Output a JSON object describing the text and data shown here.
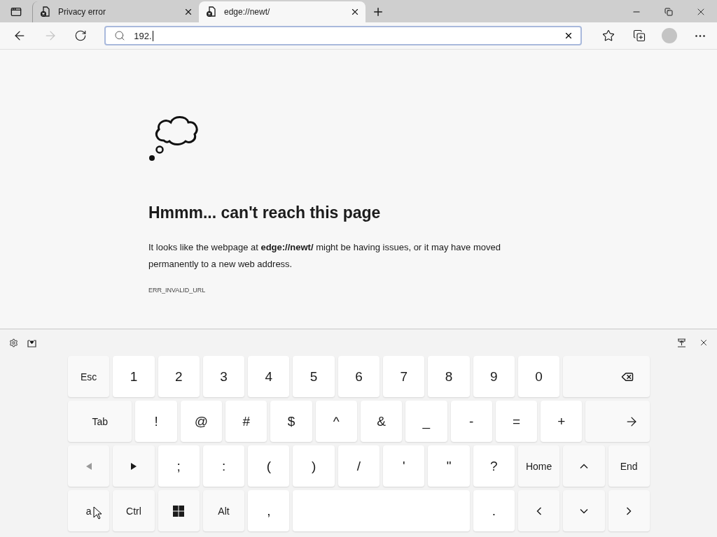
{
  "tabs": [
    {
      "title": "Privacy error",
      "selected": false
    },
    {
      "title": "edge://newt/",
      "selected": true
    }
  ],
  "address_bar": {
    "value": "192."
  },
  "error_page": {
    "heading": "Hmmm... can't reach this page",
    "message": "It looks like the webpage at **edge://newt/** might be having issues, or it may have moved permanently to a new web address.",
    "code": "ERR_INVALID_URL"
  },
  "keyboard": {
    "rows": [
      {
        "keys": [
          {
            "kind": "label",
            "label": "Esc"
          },
          {
            "kind": "char",
            "label": "1"
          },
          {
            "kind": "char",
            "label": "2"
          },
          {
            "kind": "char",
            "label": "3"
          },
          {
            "kind": "char",
            "label": "4"
          },
          {
            "kind": "char",
            "label": "5"
          },
          {
            "kind": "char",
            "label": "6"
          },
          {
            "kind": "char",
            "label": "7"
          },
          {
            "kind": "char",
            "label": "8"
          },
          {
            "kind": "char",
            "label": "9"
          },
          {
            "kind": "char",
            "label": "0"
          },
          {
            "kind": "backspace"
          }
        ]
      },
      {
        "keys": [
          {
            "kind": "tab",
            "label": "Tab"
          },
          {
            "kind": "char",
            "label": "!"
          },
          {
            "kind": "char",
            "label": "@"
          },
          {
            "kind": "char",
            "label": "#"
          },
          {
            "kind": "char",
            "label": "$"
          },
          {
            "kind": "char",
            "label": "^"
          },
          {
            "kind": "char",
            "label": "&"
          },
          {
            "kind": "char",
            "label": "_"
          },
          {
            "kind": "char",
            "label": "-"
          },
          {
            "kind": "char",
            "label": "="
          },
          {
            "kind": "char",
            "label": "+"
          },
          {
            "kind": "enter"
          }
        ]
      },
      {
        "keys": [
          {
            "kind": "prev"
          },
          {
            "kind": "next"
          },
          {
            "kind": "char",
            "label": ";"
          },
          {
            "kind": "char",
            "label": ":"
          },
          {
            "kind": "char",
            "label": "("
          },
          {
            "kind": "char",
            "label": ")"
          },
          {
            "kind": "char",
            "label": "/"
          },
          {
            "kind": "char",
            "label": "'"
          },
          {
            "kind": "char",
            "label": "\""
          },
          {
            "kind": "char",
            "label": "?"
          },
          {
            "kind": "label",
            "label": "Home"
          },
          {
            "kind": "up"
          },
          {
            "kind": "label",
            "label": "End"
          }
        ]
      },
      {
        "keys": [
          {
            "kind": "label",
            "label": "a"
          },
          {
            "kind": "label",
            "label": "Ctrl"
          },
          {
            "kind": "windows"
          },
          {
            "kind": "label",
            "label": "Alt"
          },
          {
            "kind": "char",
            "label": ","
          },
          {
            "kind": "space"
          },
          {
            "kind": "char",
            "label": "."
          },
          {
            "kind": "left"
          },
          {
            "kind": "down"
          },
          {
            "kind": "right"
          }
        ]
      }
    ]
  }
}
